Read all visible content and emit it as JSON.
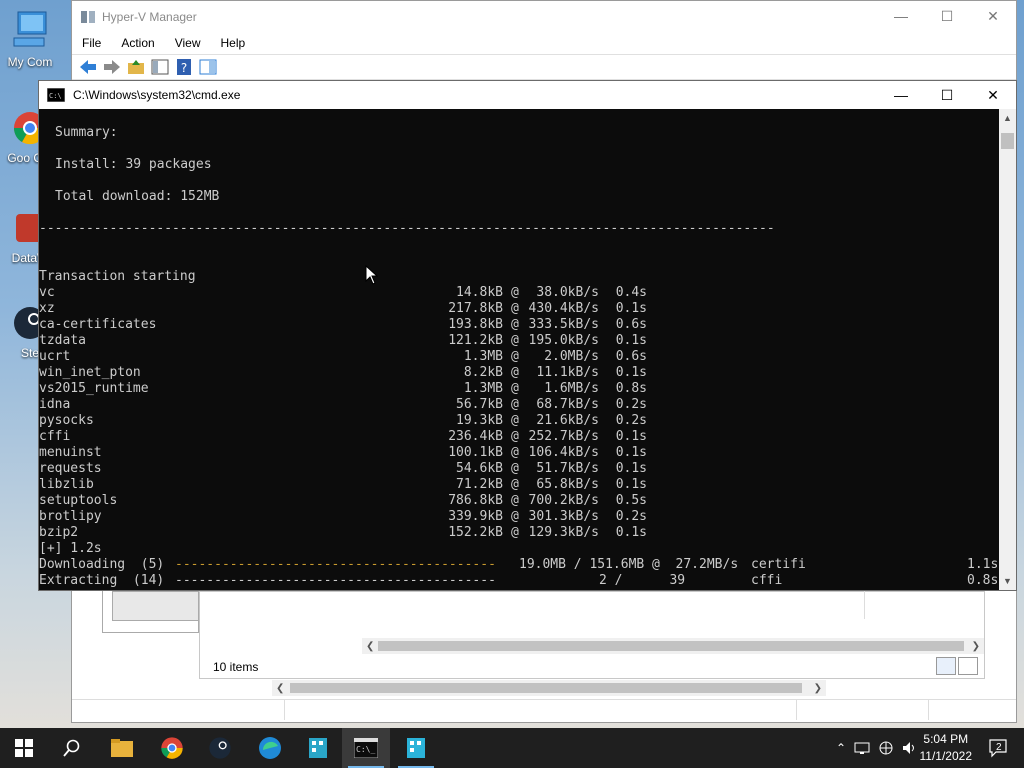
{
  "desktop": {
    "icons": [
      {
        "label": "My Com",
        "name": "my-computer"
      },
      {
        "label": "Goo Chr",
        "name": "google-chrome"
      },
      {
        "label": "DataW",
        "name": "datawrangler"
      },
      {
        "label": "Ste",
        "name": "steam"
      }
    ]
  },
  "hyperv": {
    "title": "Hyper-V Manager",
    "menu": [
      "File",
      "Action",
      "View",
      "Help"
    ],
    "items_count": "10 items"
  },
  "cmd": {
    "title": "C:\\Windows\\system32\\cmd.exe",
    "summary_lines": [
      "Summary:",
      "",
      "Install: 39 packages",
      "",
      "Total download: 152MB",
      "",
      "----------------------------------------------------------------------------------------------",
      "",
      ""
    ],
    "transaction_start": "Transaction starting",
    "packages": [
      {
        "name": "vc",
        "size": "14.8kB",
        "speed": "38.0kB/s",
        "time": "0.4s"
      },
      {
        "name": "xz",
        "size": "217.8kB",
        "speed": "430.4kB/s",
        "time": "0.1s"
      },
      {
        "name": "ca-certificates",
        "size": "193.8kB",
        "speed": "333.5kB/s",
        "time": "0.6s"
      },
      {
        "name": "tzdata",
        "size": "121.2kB",
        "speed": "195.0kB/s",
        "time": "0.1s"
      },
      {
        "name": "ucrt",
        "size": "1.3MB",
        "speed": "2.0MB/s",
        "time": "0.6s"
      },
      {
        "name": "win_inet_pton",
        "size": "8.2kB",
        "speed": "11.1kB/s",
        "time": "0.1s"
      },
      {
        "name": "vs2015_runtime",
        "size": "1.3MB",
        "speed": "1.6MB/s",
        "time": "0.8s"
      },
      {
        "name": "idna",
        "size": "56.7kB",
        "speed": "68.7kB/s",
        "time": "0.2s"
      },
      {
        "name": "pysocks",
        "size": "19.3kB",
        "speed": "21.6kB/s",
        "time": "0.2s"
      },
      {
        "name": "cffi",
        "size": "236.4kB",
        "speed": "252.7kB/s",
        "time": "0.1s"
      },
      {
        "name": "menuinst",
        "size": "100.1kB",
        "speed": "106.4kB/s",
        "time": "0.1s"
      },
      {
        "name": "requests",
        "size": "54.6kB",
        "speed": "51.7kB/s",
        "time": "0.1s"
      },
      {
        "name": "libzlib",
        "size": "71.2kB",
        "speed": "65.8kB/s",
        "time": "0.1s"
      },
      {
        "name": "setuptools",
        "size": "786.8kB",
        "speed": "700.2kB/s",
        "time": "0.5s"
      },
      {
        "name": "brotlipy",
        "size": "339.9kB",
        "speed": "301.3kB/s",
        "time": "0.2s"
      },
      {
        "name": "bzip2",
        "size": "152.2kB",
        "speed": "129.3kB/s",
        "time": "0.1s"
      }
    ],
    "elapsed": "[+] 1.2s",
    "downloading": {
      "label": "Downloading  (5)",
      "progress": "19.0MB / 151.6MB @  27.2MB/s",
      "current": "certifi",
      "time": "1.1s"
    },
    "extracting": {
      "label": "Extracting  (14)",
      "progress": "2 /      39",
      "current": "cffi",
      "time": "0.8s"
    }
  },
  "taskbar": {
    "apps": [
      "start",
      "search",
      "file-explorer",
      "chrome",
      "steam",
      "edge",
      "app-green",
      "cmd",
      "app-blue"
    ],
    "time": "5:04 PM",
    "date": "11/1/2022",
    "notification_count": "2"
  }
}
